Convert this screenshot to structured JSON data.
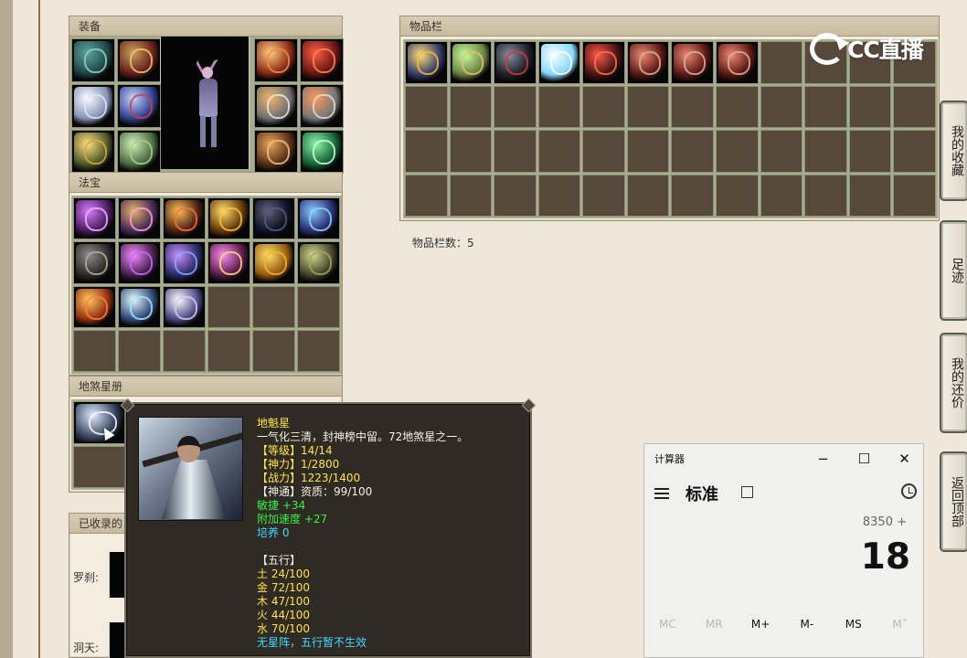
{
  "panels": {
    "equipment": "装备",
    "treasure": "法宝",
    "star_book": "地煞星册",
    "collected": "已收录的",
    "inventory": "物品栏"
  },
  "inventory_count": "物品栏数：5",
  "left_rows": {
    "rakshasa": "罗刹:",
    "cave": "洞天:"
  },
  "tooltip": {
    "name": "地魁星",
    "description": "一气化三清，封神榜中留。72地煞星之一。",
    "level": "【等级】14/14",
    "divine_power": "【神力】1/2800",
    "combat_power": "【战力】1223/1400",
    "divine_talent": "【神通】资质：99/100",
    "agility": "敏捷 +34",
    "attack_speed": "附加速度 +27",
    "cultivation": "培养 0",
    "five_elements_title": "【五行】",
    "earth": "土 24/100",
    "metal": "金 72/100",
    "wood": "木 47/100",
    "fire": "火 44/100",
    "water": "水 70/100",
    "formation_note": "无星阵，五行暂不生效"
  },
  "logo": "CC直播",
  "side_buttons": [
    "我的收藏",
    "足迹",
    "我的还价",
    "返回顶部"
  ],
  "calculator": {
    "title": "计算器",
    "minimize": "−",
    "maximize": "☐",
    "close": "✕",
    "mode": "标准",
    "expression": "8350 +",
    "display": "18",
    "memory": [
      "MC",
      "MR",
      "M+",
      "M-",
      "MS",
      "M˅"
    ]
  },
  "colors": {
    "tooltip_yellow": "#ffe34b",
    "tooltip_green": "#39f04a",
    "tooltip_cyan": "#43d9ff"
  }
}
